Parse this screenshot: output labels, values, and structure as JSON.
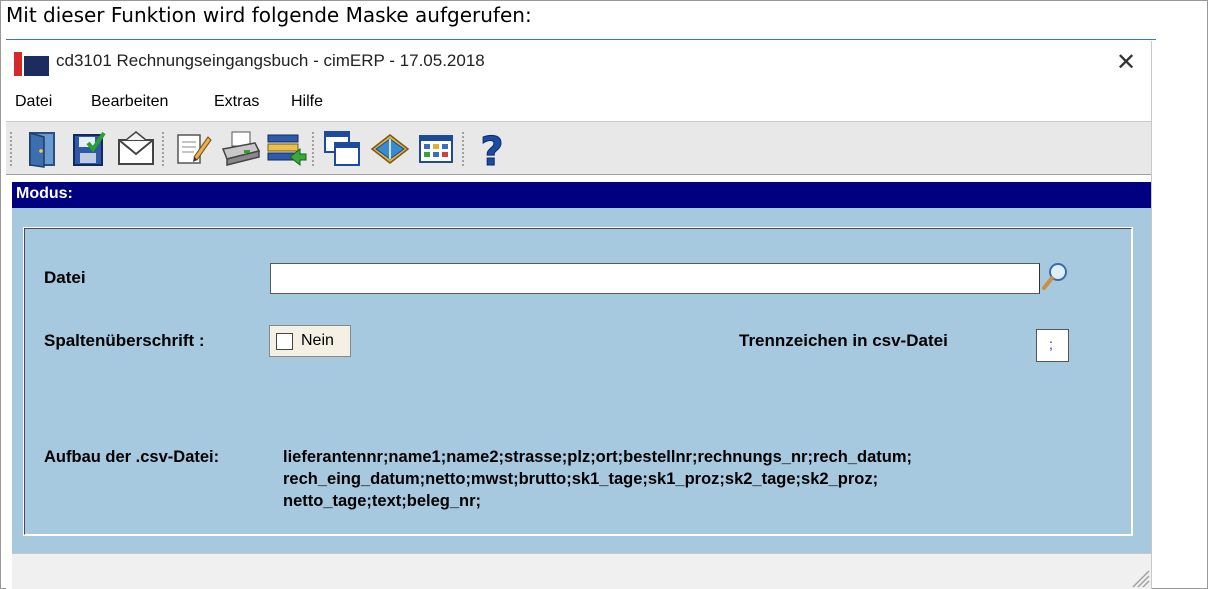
{
  "caption": "Mit dieser Funktion wird folgende Maske aufgerufen:",
  "window": {
    "title": "cd3101 Rechnungseingangsbuch - cimERP - 17.05.2018",
    "close_glyph": "✕"
  },
  "menu": [
    "Datei",
    "Bearbeiten",
    "Extras",
    "Hilfe"
  ],
  "toolbar": {
    "buttons": [
      "exit-door-icon",
      "save-icon",
      "mail-icon",
      "edit-sheet-icon",
      "print-icon",
      "export-icon",
      "window-icon",
      "book-icon",
      "calendar-grid-icon",
      "help-icon"
    ],
    "help_glyph": "?"
  },
  "modus": {
    "label": "Modus:"
  },
  "form": {
    "datei_label": "Datei",
    "datei_value": "",
    "spalten_label": "Spaltenüberschrift :",
    "spalten_value": "Nein",
    "trenn_label": "Trennzeichen in csv-Datei",
    "trenn_value": ";",
    "aufbau_label": "Aufbau der .csv-Datei:",
    "aufbau_lines": [
      "lieferantennr;name1;name2;strasse;plz;ort;bestellnr;rechnungs_nr;rech_datum;",
      "rech_eing_datum;netto;mwst;brutto;sk1_tage;sk1_proz;sk2_tage;sk2_proz;",
      "netto_tage;text;beleg_nr;"
    ]
  },
  "colors": {
    "modus_bar": "#000080",
    "panel_bg": "#a6c9e0",
    "toolbar_bg": "#e8e8e8"
  }
}
